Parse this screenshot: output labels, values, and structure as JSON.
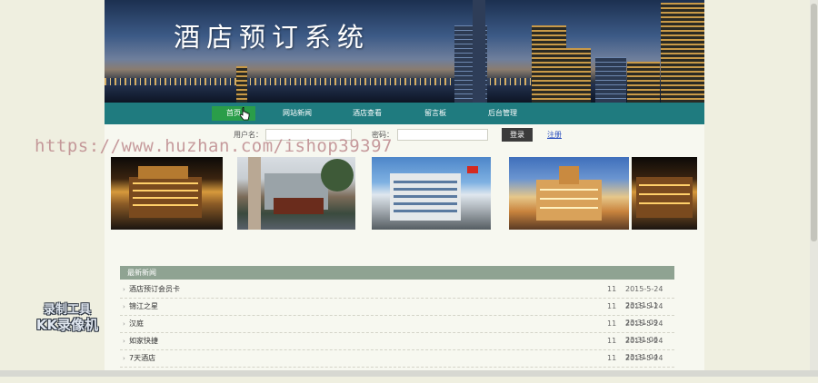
{
  "site": {
    "title": "酒店预订系统"
  },
  "nav": {
    "items": [
      {
        "label": "首页",
        "active": true
      },
      {
        "label": "网站新闻",
        "active": false
      },
      {
        "label": "酒店查看",
        "active": false
      },
      {
        "label": "留言板",
        "active": false
      },
      {
        "label": "后台管理",
        "active": false
      }
    ]
  },
  "login": {
    "username_label": "用户名：",
    "username_value": "",
    "password_label": "密码：",
    "password_value": "",
    "login_button": "登录",
    "register_link": "注册"
  },
  "watermark": "https://www.huzhan.com/ishop39397",
  "news": {
    "header": "最新新闻",
    "items": [
      {
        "title": "酒店预订会员卡",
        "count": "11",
        "date": "2015-5-24 23:31:11"
      },
      {
        "title": "锦江之星",
        "count": "11",
        "date": "2015-5-24 23:31:09"
      },
      {
        "title": "汉庭",
        "count": "11",
        "date": "2015-5-24 23:31:06"
      },
      {
        "title": "如家快捷",
        "count": "11",
        "date": "2015-5-24 23:31:04"
      },
      {
        "title": "7天酒店",
        "count": "11",
        "date": "2015-5-24 23:31:02"
      }
    ]
  },
  "recorder": {
    "line1": "录制工具",
    "line2": "KK录像机"
  },
  "colors": {
    "nav_bg": "#1f7b7f",
    "nav_active": "#2a9d49",
    "news_header": "#8fa392"
  }
}
